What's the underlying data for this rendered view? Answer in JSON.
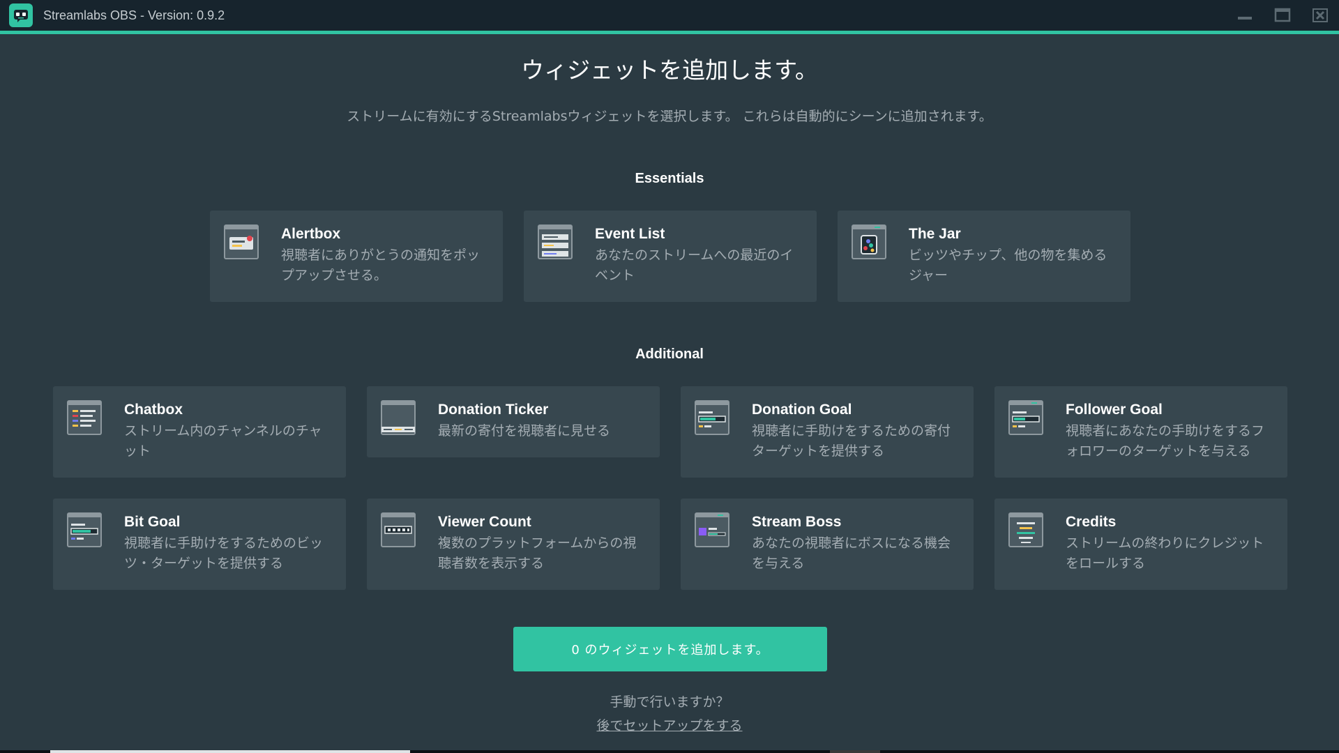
{
  "window": {
    "title": "Streamlabs OBS - Version: 0.9.2"
  },
  "page": {
    "title": "ウィジェットを追加します。",
    "subtitle": "ストリームに有効にするStreamlabsウィジェットを選択します。 これらは自動的にシーンに追加されます。"
  },
  "essentials": {
    "heading": "Essentials",
    "widgets": [
      {
        "name": "Alertbox",
        "description": "視聴者にありがとうの通知をポップアップさせる。",
        "icon": "alertbox-icon"
      },
      {
        "name": "Event List",
        "description": "あなたのストリームへの最近のイベント",
        "icon": "event-list-icon"
      },
      {
        "name": "The Jar",
        "description": "ビッツやチップ、他の物を集めるジャー",
        "icon": "the-jar-icon"
      }
    ]
  },
  "additional": {
    "heading": "Additional",
    "widgets": [
      {
        "name": "Chatbox",
        "description": "ストリーム内のチャンネルのチャット",
        "icon": "chatbox-icon"
      },
      {
        "name": "Donation Ticker",
        "description": "最新の寄付を視聴者に見せる",
        "icon": "donation-ticker-icon"
      },
      {
        "name": "Donation Goal",
        "description": "視聴者に手助けをするための寄付ターゲットを提供する",
        "icon": "donation-goal-icon"
      },
      {
        "name": "Follower Goal",
        "description": "視聴者にあなたの手助けをするフォロワーのターゲットを与える",
        "icon": "follower-goal-icon"
      },
      {
        "name": "Bit Goal",
        "description": "視聴者に手助けをするためのビッツ・ターゲットを提供する",
        "icon": "bit-goal-icon"
      },
      {
        "name": "Viewer Count",
        "description": "複数のプラットフォームからの視聴者数を表示する",
        "icon": "viewer-count-icon"
      },
      {
        "name": "Stream Boss",
        "description": "あなたの視聴者にボスになる機会を与える",
        "icon": "stream-boss-icon"
      },
      {
        "name": "Credits",
        "description": "ストリームの終わりにクレジットをロールする",
        "icon": "credits-icon"
      }
    ]
  },
  "actions": {
    "add_button": "0 のウィジェットを追加します。",
    "manual_question": "手動で行いますか？",
    "setup_later": "後でセットアップをする"
  },
  "colors": {
    "accent": "#31c3a2",
    "background": "#2b3a42",
    "card": "#37474f",
    "titlebar": "#17242d"
  }
}
